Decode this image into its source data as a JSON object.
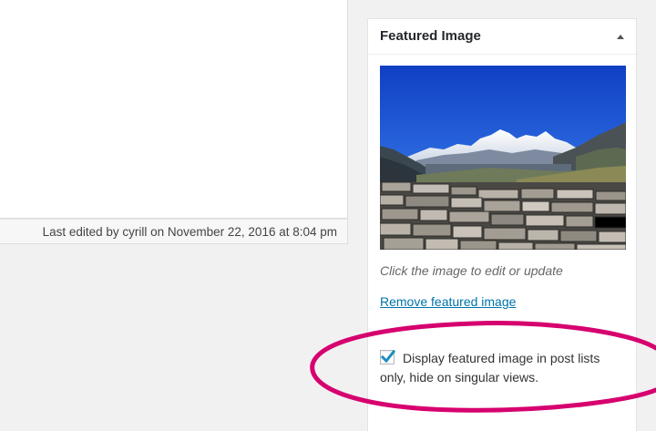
{
  "editor": {
    "last_edited": "Last edited by cyrill on November 22, 2016 at 8:04 pm"
  },
  "featured_image_box": {
    "title": "Featured Image",
    "toggle_icon": "triangle-up-icon",
    "image_description": "mountain-landscape-with-stone-wall",
    "hint": "Click the image to edit or update",
    "remove_link": "Remove featured image",
    "option_checked": true,
    "option_label": "Display featured image in post lists only, hide on singular views."
  },
  "colors": {
    "link": "#0073aa",
    "checkmark": "#1e8cbe",
    "annotation": "#d6006f",
    "background": "#f1f1f1"
  }
}
